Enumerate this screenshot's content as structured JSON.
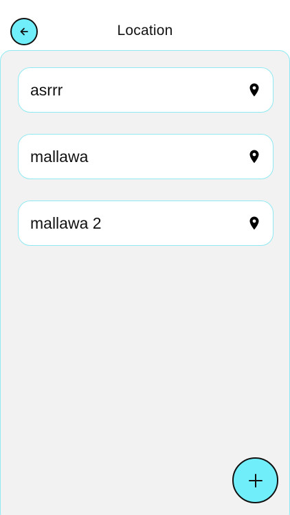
{
  "header": {
    "title": "Location",
    "back_icon": "arrow-left-icon"
  },
  "locations": [
    {
      "name": "asrrr",
      "icon": "map-pin-icon"
    },
    {
      "name": "mallawa",
      "icon": "map-pin-icon"
    },
    {
      "name": "mallawa 2",
      "icon": "map-pin-icon"
    }
  ],
  "fab": {
    "icon": "plus-icon"
  },
  "colors": {
    "accent": "#70EFFB",
    "border": "#8ee9f2",
    "panel_bg": "#f2f2f2",
    "text": "#111111"
  }
}
